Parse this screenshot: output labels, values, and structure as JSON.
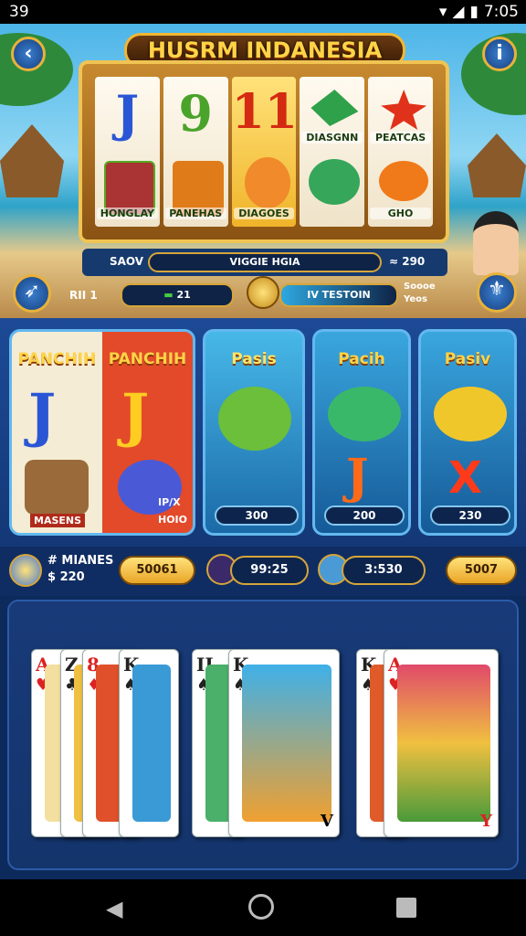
{
  "status": {
    "left_text": "39",
    "right_time": "7:05"
  },
  "header": {
    "title": "HUSRM INDANESIA",
    "back_icon": "back-arrow-icon",
    "info_icon": "info-icon"
  },
  "reels": [
    {
      "top": "J",
      "bottom_label": "HONGLAY"
    },
    {
      "top": "9",
      "bottom_label": "PANEHAS"
    },
    {
      "top": "11",
      "bottom_label": "DIAGOES"
    },
    {
      "top_label": "DIASGNN",
      "bottom_label": ""
    },
    {
      "top_label": "PEATCAS",
      "bottom_label": "GHO"
    }
  ],
  "infobar": {
    "left_label": "SAOV",
    "center_label": "VIGGIE HGIA",
    "right_value": "≈ 290"
  },
  "controls": {
    "bet_label": "RII 1",
    "bet_value": "21",
    "meter_label": "IV TESTOIN",
    "side_text1": "Soooe",
    "side_text2": "Yeos"
  },
  "panels": [
    {
      "title": "PANCHIH",
      "label": "MASENS"
    },
    {
      "title": "PANCHIH",
      "label": "HOIO",
      "sub": "IP/X"
    },
    {
      "title": "Pasis",
      "value": "300"
    },
    {
      "title": "Pacih",
      "value": "200"
    },
    {
      "title": "Pasiv",
      "value": "230"
    }
  ],
  "betrow": {
    "label1": "# MIANES",
    "label2": "$ 220",
    "btn1": "50061",
    "btn2": "99:25",
    "btn3": "3:530",
    "btn4": "5007"
  },
  "cards": [
    {
      "rank": "A",
      "suit": "♥",
      "color": "#d22"
    },
    {
      "rank": "Z",
      "suit": "♣",
      "color": "#222"
    },
    {
      "rank": "8",
      "suit": "♦",
      "color": "#d22"
    },
    {
      "rank": "K",
      "suit": "♠",
      "color": "#222"
    },
    {
      "rank": "II",
      "suit": "♠",
      "color": "#222"
    },
    {
      "rank": "K",
      "suit": "♠",
      "color": "#222"
    },
    {
      "rank": "K",
      "suit": "♠",
      "color": "#222"
    },
    {
      "rank": "A",
      "suit": "♥",
      "color": "#d22"
    }
  ],
  "card_bottom_rank": "V",
  "card_bottom_rank2": "Y"
}
